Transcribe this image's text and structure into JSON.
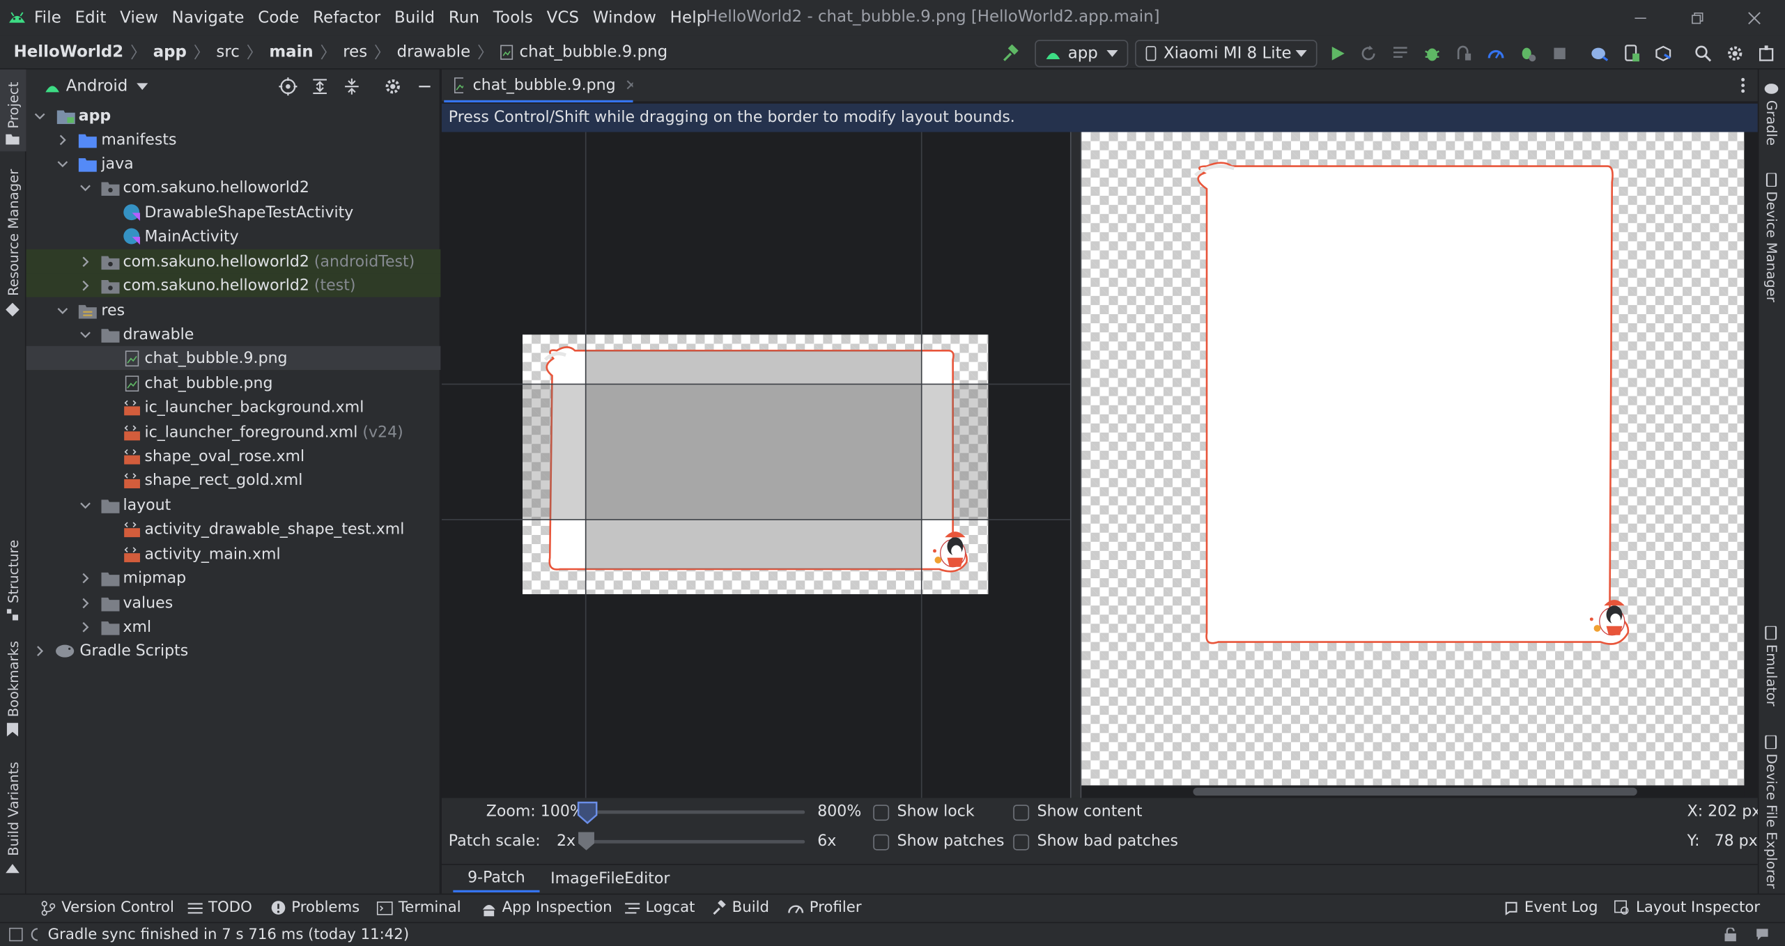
{
  "menu": [
    "File",
    "Edit",
    "View",
    "Navigate",
    "Code",
    "Refactor",
    "Build",
    "Run",
    "Tools",
    "VCS",
    "Window",
    "Help"
  ],
  "window_title": "HelloWorld2 - chat_bubble.9.png [HelloWorld2.app.main]",
  "breadcrumbs": [
    "HelloWorld2",
    "app",
    "src",
    "main",
    "res",
    "drawable",
    "chat_bubble.9.png"
  ],
  "toolbar": {
    "run_config": "app",
    "device": "Xiaomi MI 8 Lite"
  },
  "left_stripe": [
    "Project",
    "Resource Manager",
    "Structure",
    "Bookmarks",
    "Build Variants"
  ],
  "right_stripe": [
    "Gradle",
    "Device Manager",
    "Emulator",
    "Device File Explorer"
  ],
  "project_panel": {
    "view_mode": "Android"
  },
  "tree": [
    {
      "label": "app",
      "bold": true
    },
    {
      "label": "manifests"
    },
    {
      "label": "java"
    },
    {
      "label": "com.sakuno.helloworld2"
    },
    {
      "label": "DrawableShapeTestActivity"
    },
    {
      "label": "MainActivity"
    },
    {
      "label": "com.sakuno.helloworld2",
      "suffix": "(androidTest)"
    },
    {
      "label": "com.sakuno.helloworld2",
      "suffix": "(test)"
    },
    {
      "label": "res"
    },
    {
      "label": "drawable"
    },
    {
      "label": "chat_bubble.9.png",
      "selected": true
    },
    {
      "label": "chat_bubble.png"
    },
    {
      "label": "ic_launcher_background.xml"
    },
    {
      "label": "ic_launcher_foreground.xml",
      "suffix": "(v24)"
    },
    {
      "label": "shape_oval_rose.xml"
    },
    {
      "label": "shape_rect_gold.xml"
    },
    {
      "label": "layout"
    },
    {
      "label": "activity_drawable_shape_test.xml"
    },
    {
      "label": "activity_main.xml"
    },
    {
      "label": "mipmap"
    },
    {
      "label": "values"
    },
    {
      "label": "xml"
    },
    {
      "label": "Gradle Scripts"
    }
  ],
  "editor": {
    "tab_label": "chat_bubble.9.png",
    "notice": "Press Control/Shift while dragging on the border to modify layout bounds.",
    "zoom_label": "Zoom: 100%",
    "zoom_max": "800%",
    "zoom_value_percent": 100,
    "patch_scale_label": "Patch scale:",
    "patch_scale_min": "2x",
    "patch_scale_max": "6x",
    "show_lock": "Show lock",
    "show_content": "Show content",
    "show_patches": "Show patches",
    "show_bad_patches": "Show bad patches",
    "coord_x": "X: 202 px",
    "coord_y": "Y:   78 px",
    "subtabs": [
      "9-Patch",
      "ImageFileEditor"
    ]
  },
  "bottom_tools": [
    "Version Control",
    "TODO",
    "Problems",
    "Terminal",
    "App Inspection",
    "Logcat",
    "Build",
    "Profiler"
  ],
  "bottom_tools_right": [
    "Event Log",
    "Layout Inspector"
  ],
  "status": "Gradle sync finished in 7 s 716 ms (today 11:42)",
  "colors": {
    "accent": "#3574f0",
    "bubble_border": "#e8553a",
    "android_green": "#3ddc84"
  }
}
